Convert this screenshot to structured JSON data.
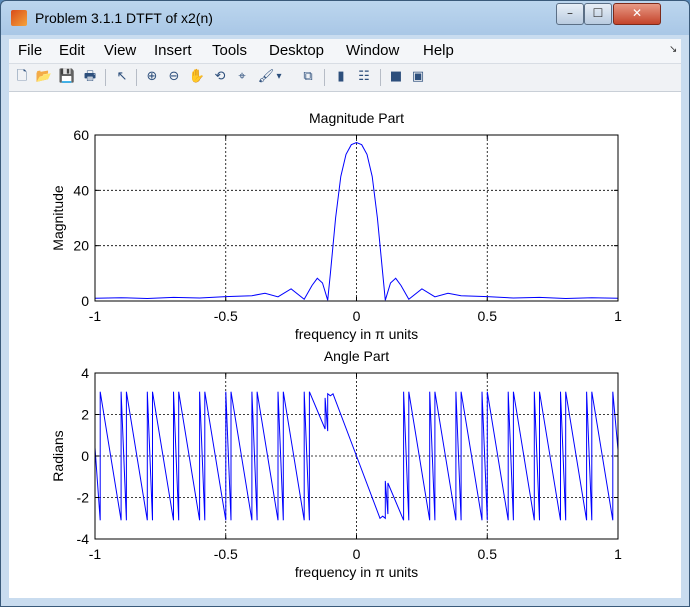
{
  "window": {
    "title": "Problem 3.1.1 DTFT of x2(n)"
  },
  "window_controls": {
    "minimize": "–",
    "maximize": "☐",
    "close": "✕"
  },
  "menu": [
    "File",
    "Edit",
    "View",
    "Insert",
    "Tools",
    "Desktop",
    "Window",
    "Help"
  ],
  "menu_extra": "↘",
  "toolbar": [
    {
      "name": "new-figure-icon",
      "glyph": "🗋"
    },
    {
      "name": "open-file-icon",
      "glyph": "📂"
    },
    {
      "name": "save-icon",
      "glyph": "💾"
    },
    {
      "name": "print-icon",
      "glyph": "🖶"
    },
    {
      "name": "edit-plot-arrow-icon",
      "glyph": "↖"
    },
    {
      "name": "zoom-in-icon",
      "glyph": "⊕"
    },
    {
      "name": "zoom-out-icon",
      "glyph": "⊖"
    },
    {
      "name": "pan-hand-icon",
      "glyph": "✋"
    },
    {
      "name": "rotate-3d-icon",
      "glyph": "⟲"
    },
    {
      "name": "data-cursor-icon",
      "glyph": "⌖"
    },
    {
      "name": "brush-icon",
      "glyph": "🖌"
    },
    {
      "name": "brush-dropdown-icon",
      "glyph": "▾"
    },
    {
      "name": "link-plot-icon",
      "glyph": "⧉"
    },
    {
      "name": "colorbar-icon",
      "glyph": "▮"
    },
    {
      "name": "legend-icon",
      "glyph": "☷"
    },
    {
      "name": "hide-plot-tools-icon",
      "glyph": "■"
    },
    {
      "name": "show-plot-tools-icon",
      "glyph": "▣"
    }
  ],
  "chart_data": [
    {
      "type": "line",
      "title": "Magnitude Part",
      "xlabel": "frequency in π units",
      "ylabel": "Magnitude",
      "xlim": [
        -1,
        1
      ],
      "ylim": [
        0,
        60
      ],
      "xticks": [
        "-1",
        "-0.5",
        "0",
        "0.5",
        "1"
      ],
      "yticks": [
        "0",
        "20",
        "40",
        "60"
      ],
      "grid": true,
      "color": "#0000ff",
      "series": [
        {
          "x": [
            -1,
            -0.9,
            -0.8,
            -0.7,
            -0.6,
            -0.5,
            -0.4,
            -0.35,
            -0.3,
            -0.25,
            -0.2,
            -0.17,
            -0.15,
            -0.13,
            -0.11,
            -0.1,
            -0.08,
            -0.06,
            -0.04,
            -0.02,
            0,
            0.02,
            0.04,
            0.06,
            0.08,
            0.1,
            0.11,
            0.13,
            0.15,
            0.17,
            0.2,
            0.25,
            0.3,
            0.35,
            0.4,
            0.5,
            0.6,
            0.7,
            0.8,
            0.9,
            1
          ],
          "y": [
            1,
            1.2,
            0.9,
            1.3,
            1.1,
            1.6,
            1.9,
            2.8,
            1.5,
            4.4,
            0.6,
            5.6,
            8.2,
            6.5,
            0.3,
            10,
            30,
            45,
            53,
            56.5,
            57.3,
            56.5,
            53,
            45,
            30,
            10,
            0.3,
            6.5,
            8.2,
            5.6,
            0.6,
            4.4,
            1.5,
            2.8,
            1.9,
            1.6,
            1.1,
            1.3,
            0.9,
            1.2,
            1
          ]
        }
      ]
    },
    {
      "type": "line",
      "title": "Angle Part",
      "xlabel": "frequency in π units",
      "ylabel": "Radians",
      "xlim": [
        -1,
        1
      ],
      "ylim": [
        -4,
        4
      ],
      "xticks": [
        "-1",
        "-0.5",
        "0",
        "0.5",
        "1"
      ],
      "yticks": [
        "-4",
        "-2",
        "0",
        "2",
        "4"
      ],
      "grid": true,
      "color": "#0000ff",
      "series": [
        {
          "x": [
            -1,
            -0.98,
            -0.98,
            -0.9,
            -0.9,
            -0.88,
            -0.88,
            -0.8,
            -0.8,
            -0.78,
            -0.78,
            -0.7,
            -0.7,
            -0.68,
            -0.68,
            -0.6,
            -0.6,
            -0.58,
            -0.58,
            -0.5,
            -0.5,
            -0.48,
            -0.48,
            -0.4,
            -0.4,
            -0.38,
            -0.38,
            -0.3,
            -0.3,
            -0.28,
            -0.28,
            -0.2,
            -0.2,
            -0.18,
            -0.18,
            -0.12,
            -0.12,
            -0.11,
            -0.11,
            -0.1,
            -0.09,
            0,
            0.09,
            0.1,
            0.11,
            0.11,
            0.12,
            0.12,
            0.18,
            0.18,
            0.2,
            0.2,
            0.28,
            0.28,
            0.3,
            0.3,
            0.38,
            0.38,
            0.4,
            0.4,
            0.48,
            0.48,
            0.5,
            0.5,
            0.58,
            0.58,
            0.6,
            0.6,
            0.68,
            0.68,
            0.7,
            0.7,
            0.78,
            0.78,
            0.8,
            0.8,
            0.88,
            0.88,
            0.9,
            0.9,
            0.98,
            0.98,
            1
          ],
          "y": [
            0.4,
            -3.1,
            3.1,
            -3.1,
            3.1,
            -3.1,
            3.1,
            -3.1,
            3.1,
            -3.1,
            3.1,
            -3.1,
            3.1,
            -3.1,
            3.1,
            -3.1,
            3.1,
            -3.1,
            3.1,
            -3.1,
            3.1,
            -3.1,
            3.1,
            -3.1,
            3.1,
            -3.1,
            3.1,
            -3.1,
            3.1,
            -3.1,
            3.1,
            -3.1,
            3.1,
            -3.1,
            3.1,
            1.3,
            2.8,
            1.2,
            3.0,
            2.9,
            3.0,
            0,
            -3.0,
            -2.9,
            -3.0,
            -1.2,
            -2.8,
            -1.3,
            -3.1,
            3.1,
            -3.1,
            3.1,
            -3.1,
            3.1,
            -3.1,
            3.1,
            -3.1,
            3.1,
            -3.1,
            3.1,
            -3.1,
            3.1,
            -3.1,
            3.1,
            -3.1,
            3.1,
            -3.1,
            3.1,
            -3.1,
            3.1,
            -3.1,
            3.1,
            -3.1,
            3.1,
            -3.1,
            3.1,
            -3.1,
            3.1,
            -3.1,
            3.1,
            -3.1,
            3.1,
            0.3
          ]
        }
      ]
    }
  ]
}
